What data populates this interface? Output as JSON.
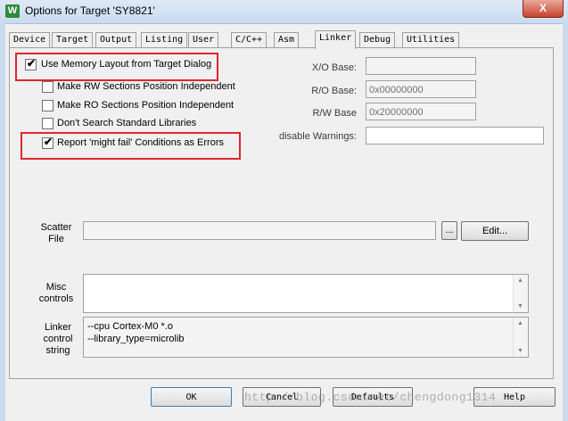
{
  "window": {
    "title": "Options for Target 'SY8821'",
    "app_icon_glyph": "W",
    "close_glyph": "X"
  },
  "tabs": [
    {
      "label": "Device"
    },
    {
      "label": "Target"
    },
    {
      "label": "Output"
    },
    {
      "label": "Listing"
    },
    {
      "label": "User"
    },
    {
      "label": "C/C++"
    },
    {
      "label": "Asm"
    },
    {
      "label": "Linker",
      "active": true
    },
    {
      "label": "Debug"
    },
    {
      "label": "Utilities"
    }
  ],
  "options": {
    "use_memory_layout": {
      "label": "Use Memory Layout from Target Dialog",
      "checked": true
    },
    "rw_independent": {
      "label": "Make RW Sections Position Independent",
      "checked": false
    },
    "ro_independent": {
      "label": "Make RO Sections Position Independent",
      "checked": false
    },
    "dont_search_std": {
      "label": "Don't Search Standard Libraries",
      "checked": false
    },
    "might_fail_errors": {
      "label": "Report 'might fail' Conditions as Errors",
      "checked": true
    }
  },
  "fields": {
    "xo_base": {
      "label": "X/O Base:",
      "value": ""
    },
    "ro_base": {
      "label": "R/O Base:",
      "value": "0x00000000"
    },
    "rw_base": {
      "label": "R/W Base",
      "value": "0x20000000"
    },
    "disable_warnings": {
      "label": "disable Warnings:",
      "value": ""
    }
  },
  "scatter": {
    "label_line1": "Scatter",
    "label_line2": "File",
    "browse_label": "...",
    "edit_label": "Edit..."
  },
  "misc": {
    "label_line1": "Misc",
    "label_line2": "controls"
  },
  "linker_control": {
    "label_line1": "Linker",
    "label_line2": "control",
    "label_line3": "string",
    "lines": [
      "--cpu Cortex-M0 *.o",
      "--library_type=microlib"
    ]
  },
  "buttons": {
    "ok": "OK",
    "cancel": "Cancel",
    "defaults": "Defaults",
    "help": "Help"
  },
  "watermark": "http://blog.csdn.net/chengdong1314",
  "colors": {
    "highlight_box": "#e0262f",
    "title_bar": "#c9dbee",
    "close_button": "#c7422d"
  }
}
